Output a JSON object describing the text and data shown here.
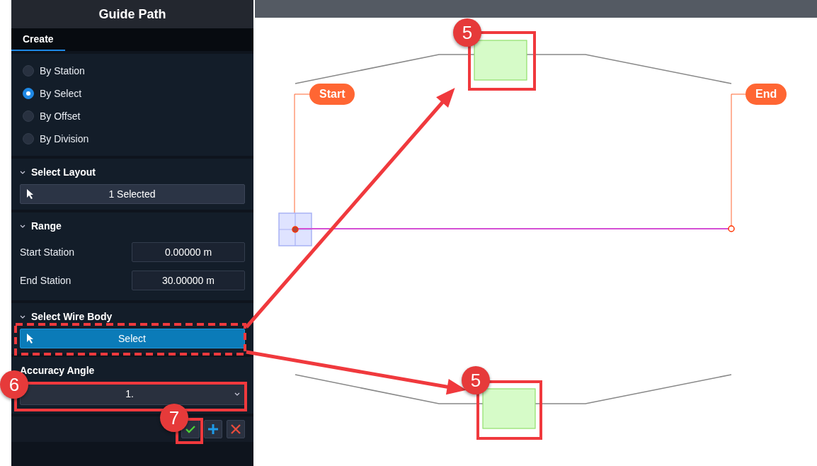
{
  "panel": {
    "title": "Guide Path",
    "tabs": [
      {
        "label": "Create",
        "selected": true
      }
    ],
    "modes": [
      {
        "label": "By Station",
        "selected": false
      },
      {
        "label": "By Select",
        "selected": true
      },
      {
        "label": "By Offset",
        "selected": false
      },
      {
        "label": "By Division",
        "selected": false
      }
    ],
    "sections": [
      {
        "kind": "select",
        "title": "Select Layout",
        "expanded": true,
        "button": "1 Selected",
        "active": false
      },
      {
        "kind": "range",
        "title": "Range",
        "expanded": true,
        "fields": [
          {
            "label": "Start Station",
            "value": "0.00000 m"
          },
          {
            "label": "End Station",
            "value": "30.00000 m"
          }
        ]
      },
      {
        "kind": "select",
        "title": "Select Wire Body",
        "expanded": true,
        "button": "Select",
        "active": true
      },
      {
        "kind": "dropdown",
        "title": "Accuracy Angle",
        "value": "1."
      }
    ],
    "actions": [
      {
        "kind": "confirm"
      },
      {
        "kind": "add"
      },
      {
        "kind": "cancel"
      }
    ]
  },
  "canvas": {
    "labels": [
      {
        "text": "Start"
      },
      {
        "text": "End"
      }
    ]
  },
  "callouts": [
    {
      "number": "5"
    },
    {
      "number": "5"
    },
    {
      "number": "6"
    },
    {
      "number": "7"
    }
  ]
}
